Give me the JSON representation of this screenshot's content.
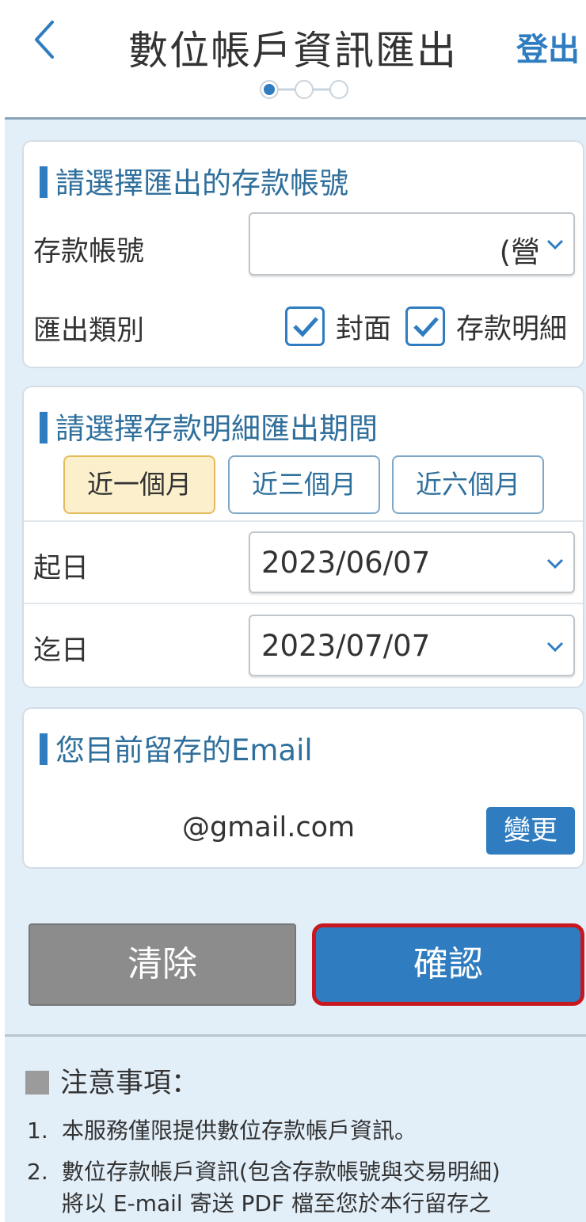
{
  "header": {
    "title": "數位帳戶資訊匯出",
    "logout_label": "登出"
  },
  "account_section": {
    "title": "請選擇匯出的存款帳號",
    "account_label": "存款帳號",
    "account_value": "(營",
    "export_type_label": "匯出類別",
    "checkboxes": [
      {
        "label": "封面",
        "checked": true
      },
      {
        "label": "存款明細",
        "checked": true
      }
    ]
  },
  "period_section": {
    "title": "請選擇存款明細匯出期間",
    "period_buttons": [
      "近一個月",
      "近三個月",
      "近六個月"
    ],
    "active_period": "近一個月",
    "start_label": "起日",
    "start_date": "2023/06/07",
    "end_label": "迄日",
    "end_date": "2023/07/07"
  },
  "email_section": {
    "title": "您目前留存的Email",
    "email": "@gmail.com",
    "change_label": "變更"
  },
  "actions": {
    "clear_label": "清除",
    "confirm_label": "確認"
  },
  "notes": {
    "title": "注意事項：",
    "items": [
      {
        "num": "1.",
        "text": "本服務僅限提供數位存款帳戶資訊。"
      },
      {
        "num": "2.",
        "text": "數位存款帳戶資訊(包含存款帳號與交易明細)"
      }
    ],
    "continuation": "將以 E-mail 寄送 PDF 檔至您於本行留存之"
  },
  "colors": {
    "accent": "#2f7dc0",
    "confirm_outline": "#c8171f",
    "background": "#e2eff9"
  }
}
